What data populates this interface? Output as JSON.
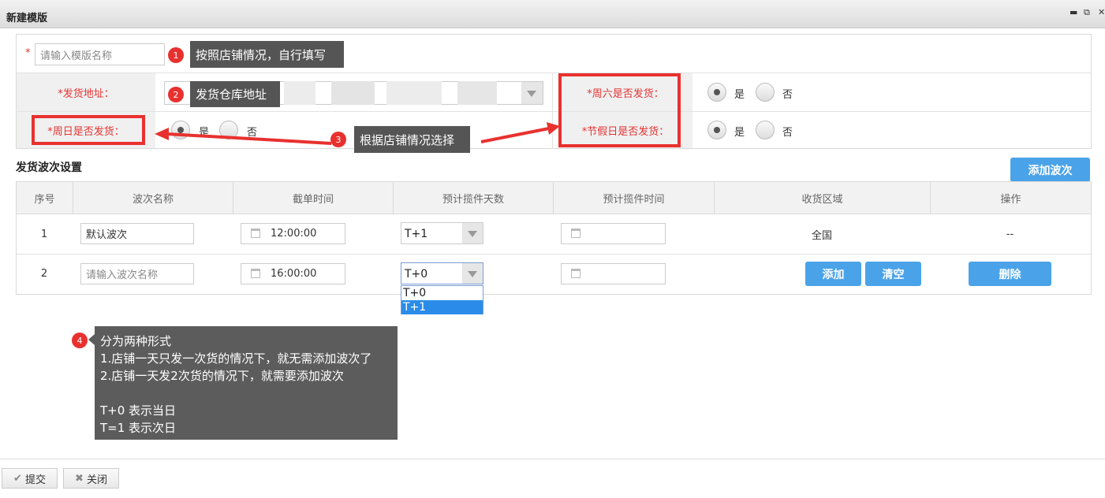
{
  "window": {
    "title": "新建模版"
  },
  "form": {
    "required_mark": "*",
    "template_name_placeholder": "请输入模版名称",
    "ship_address_label": "*发货地址：",
    "sunday_label": "*周日是否发货：",
    "saturday_label": "*周六是否发货：",
    "holiday_label": "*节假日是否发货：",
    "yes": "是",
    "no": "否"
  },
  "callouts": [
    {
      "num": "1",
      "text": "按照店铺情况，自行填写"
    },
    {
      "num": "2",
      "text": "发货仓库地址"
    },
    {
      "num": "3",
      "text": "根据店铺情况选择"
    },
    {
      "num": "4"
    }
  ],
  "waves": {
    "section_title": "发货波次设置",
    "add_wave_label": "添加波次",
    "columns": [
      "序号",
      "波次名称",
      "截单时间",
      "预计揽件天数",
      "预计揽件时间",
      "收货区域",
      "操作"
    ],
    "rows": [
      {
        "index": "1",
        "name": "默认波次",
        "cutoff": "12:00:00",
        "days": "T+1",
        "region": "全国",
        "op": "--"
      },
      {
        "index": "2",
        "name_placeholder": "请输入波次名称",
        "cutoff": "16:00:00",
        "days": "T+0",
        "add_label": "添加",
        "clear_label": "清空",
        "delete_label": "删除"
      }
    ],
    "dropdown_options": [
      "T+0",
      "T+1"
    ],
    "dropdown_selected": "T+1"
  },
  "note": {
    "lines": [
      "分为两种形式",
      "1.店铺一天只发一次货的情况下，就无需添加波次了",
      "2.店铺一天发2次货的情况下，就需要添加波次",
      "",
      "T+0 表示当日",
      "T=1 表示次日"
    ]
  },
  "footer": {
    "submit_label": "提交",
    "close_label": "关闭"
  },
  "colors": {
    "accent": "#4aa3e8",
    "highlight": "#e8312f",
    "callout_bg": "#555555"
  }
}
